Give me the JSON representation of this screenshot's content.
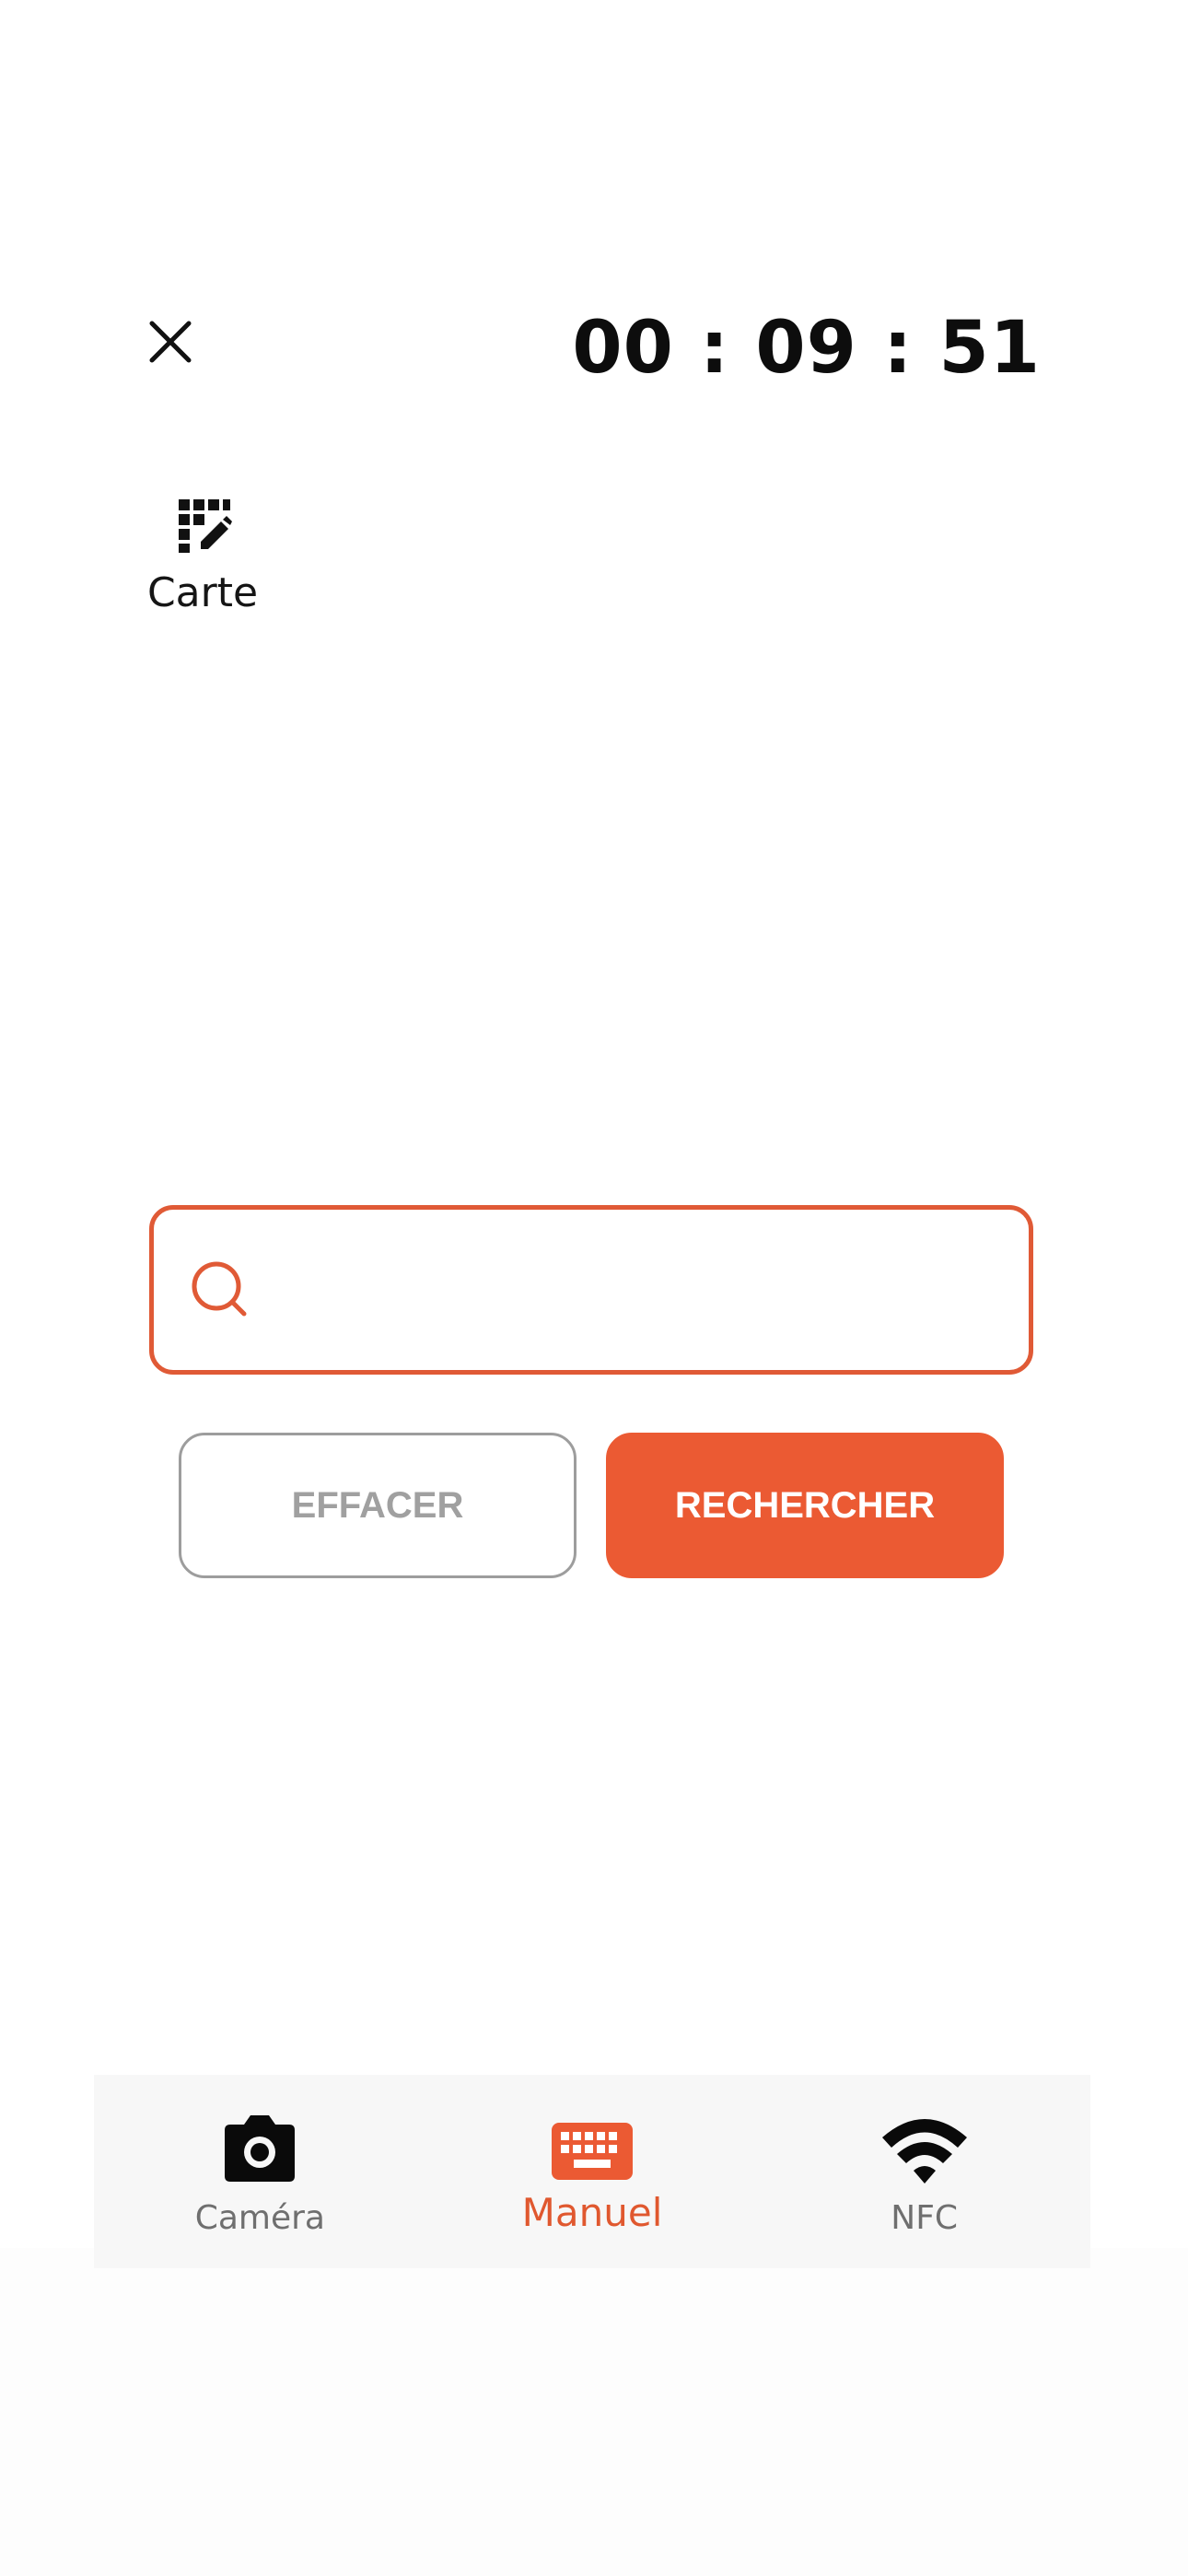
{
  "header": {
    "close_icon": "close-icon",
    "timer": "00 : 09 : 51"
  },
  "mode": {
    "icon": "keypad-edit-icon",
    "label": "Carte"
  },
  "search": {
    "icon": "search-icon",
    "value": "",
    "placeholder": ""
  },
  "actions": {
    "clear_label": "EFFACER",
    "search_label": "RECHERCHER"
  },
  "bottom_nav": {
    "items": [
      {
        "label": "Caméra",
        "icon": "camera-icon",
        "active": false
      },
      {
        "label": "Manuel",
        "icon": "keyboard-icon",
        "active": true
      },
      {
        "label": "NFC",
        "icon": "wifi-icon",
        "active": false
      }
    ]
  },
  "colors": {
    "accent": "#eb5a33",
    "border_accent": "#e05a36",
    "text_dark": "#0d0d0d",
    "text_muted": "#6f6f6f",
    "button_outline": "#9d9d9d",
    "nav_background": "#f7f7f7"
  }
}
